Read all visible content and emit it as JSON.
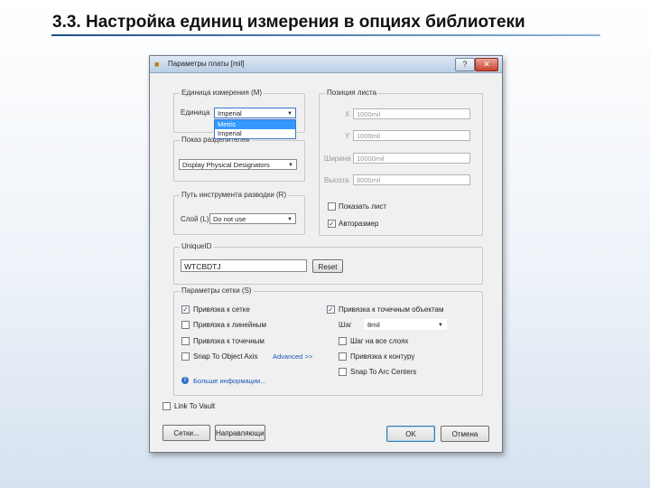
{
  "slide": {
    "title": "3.3. Настройка единиц измерения в опциях библиотеки"
  },
  "dialog": {
    "title": "Параметры платы [mil]",
    "help_glyph": "?",
    "close_glyph": "✕",
    "units_group": {
      "legend": "Единица измерения (M)",
      "label": "Единица",
      "selected": "Imperial",
      "options": [
        "Metric",
        "Imperial"
      ],
      "highlighted_option": "Metric"
    },
    "designator_group": {
      "legend": "Показ разделителей",
      "selected": "Display Physical Designators"
    },
    "route_tool_group": {
      "legend": "Путь инструмента разводки (R)",
      "label": "Слой (L)",
      "selected": "Do not use"
    },
    "sheet_position_group": {
      "legend": "Позиция листа",
      "x_label": "X",
      "x_value": "1000mil",
      "y_label": "Y",
      "y_value": "1000mil",
      "width_label": "Ширина",
      "width_value": "10000mil",
      "height_label": "Высота",
      "height_value": "8000mil",
      "show_sheet_label": "Показать лист",
      "show_sheet_checked": false,
      "autosize_label": "Авторазмер",
      "autosize_checked": true
    },
    "unique_id_group": {
      "legend": "UniqueID",
      "value": "WTCBDTJ",
      "reset_label": "Reset"
    },
    "snap_group": {
      "legend": "Параметры сетки (S)",
      "snap_to_grid_label": "Привязка к сетке",
      "snap_to_grid_checked": true,
      "snap_to_linear_label": "Привязка к линейным",
      "snap_to_linear_checked": false,
      "snap_to_point_label": "Привязка к точечным",
      "snap_to_point_checked": false,
      "snap_to_object_axis_label": "Snap To Object Axis",
      "snap_to_object_axis_checked": false,
      "advanced_link": "Advanced >>",
      "more_info_link": "Больше информации...",
      "snap_to_objects_label": "Привязка к точечным объектам",
      "snap_to_objects_checked": true,
      "step_label": "Шаг",
      "step_value": "8mil",
      "snap_to_all_layers_label": "Шаг на все слоях",
      "snap_to_all_layers_checked": false,
      "snap_to_board_outline_label": "Привязка к контуру",
      "snap_to_board_outline_checked": false,
      "snap_to_arc_centers_label": "Snap To Arc Centers",
      "snap_to_arc_centers_checked": false
    },
    "link_to_vault_label": "Link To Vault",
    "link_to_vault_checked": false,
    "buttons": {
      "grid_label": "Сетки...",
      "guides_label": "Направляющие...",
      "ok_label": "OK",
      "cancel_label": "Отмена"
    },
    "icons": {
      "app": "pcb-board-icon",
      "info": "info-icon",
      "dropdown": "chevron-down-icon",
      "check": "checkmark-icon"
    }
  }
}
